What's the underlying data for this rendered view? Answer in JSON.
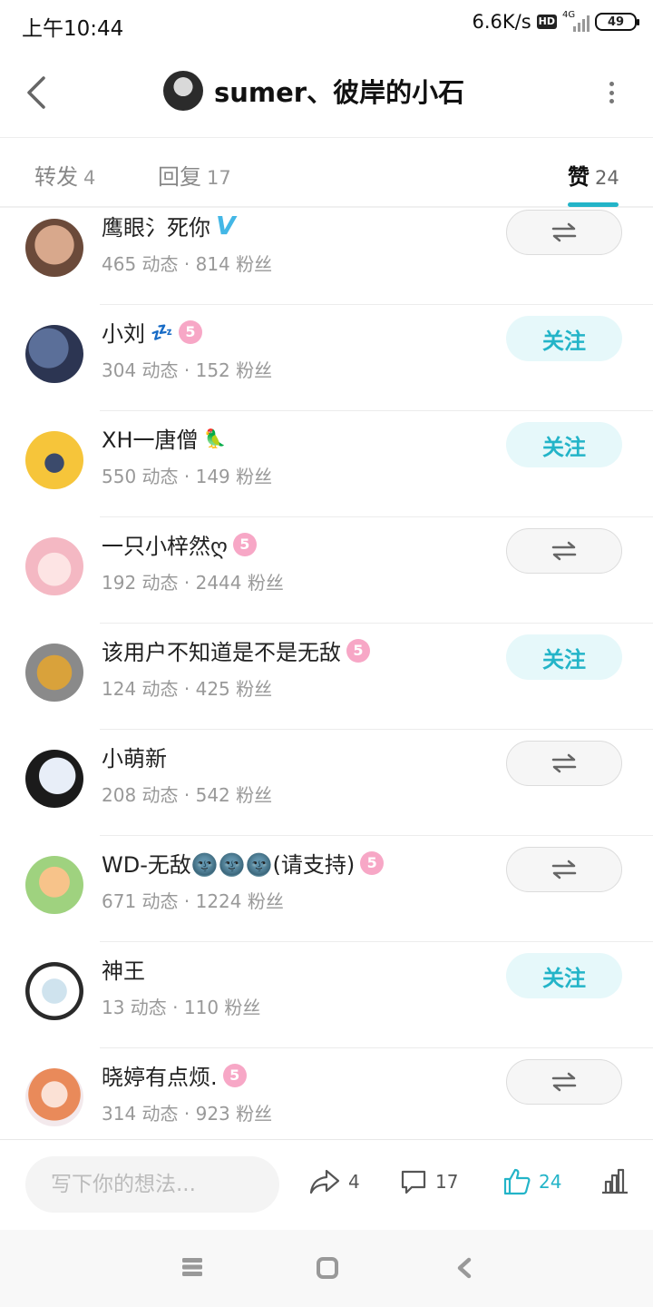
{
  "status_bar": {
    "time": "上午10:44",
    "speed": "6.6K/s",
    "hd": "HD",
    "network": "4G",
    "battery": "49"
  },
  "header": {
    "title": "sumer、彼岸的小石"
  },
  "tabs": [
    {
      "label": "转发",
      "count": "4"
    },
    {
      "label": "回复",
      "count": "17"
    },
    {
      "label": "赞",
      "count": "24",
      "active": true
    }
  ],
  "users": [
    {
      "name": "鹰眼氵死你",
      "stats": "465 动态 · 814 粉丝",
      "badge": "v",
      "button": "mutual"
    },
    {
      "name": "小刘",
      "stats": "304 动态 · 152 粉丝",
      "badge": "5",
      "button": "follow"
    },
    {
      "name": "XH一唐僧",
      "stats": "550 动态 · 149 粉丝",
      "badge": "",
      "button": "follow"
    },
    {
      "name": "一只小梓然ღ",
      "stats": "192 动态 · 2444 粉丝",
      "badge": "5",
      "button": "mutual"
    },
    {
      "name": "该用户不知道是不是无敌",
      "stats": "124 动态 · 425 粉丝",
      "badge": "5",
      "button": "follow"
    },
    {
      "name": "小萌新",
      "stats": "208 动态 · 542 粉丝",
      "badge": "",
      "button": "mutual"
    },
    {
      "name": "WD-无敌🌚🌚🌚(请支持)",
      "stats": "671 动态 · 1224 粉丝",
      "badge": "5",
      "button": "mutual"
    },
    {
      "name": "神王",
      "stats": "13 动态 · 110 粉丝",
      "badge": "",
      "button": "follow"
    },
    {
      "name": "晓婷有点烦.",
      "stats": "314 动态 · 923 粉丝",
      "badge": "5",
      "button": "mutual"
    }
  ],
  "follow_label": "关注",
  "badge_level": "5",
  "comment_placeholder": "写下你的想法...",
  "actions": {
    "share_count": "4",
    "comment_count": "17",
    "like_count": "24"
  },
  "colors": {
    "accent": "#23b4c8",
    "follow_bg": "#e6f8fa",
    "level_badge": "#f7a7c6",
    "verified": "#43b7e6"
  }
}
